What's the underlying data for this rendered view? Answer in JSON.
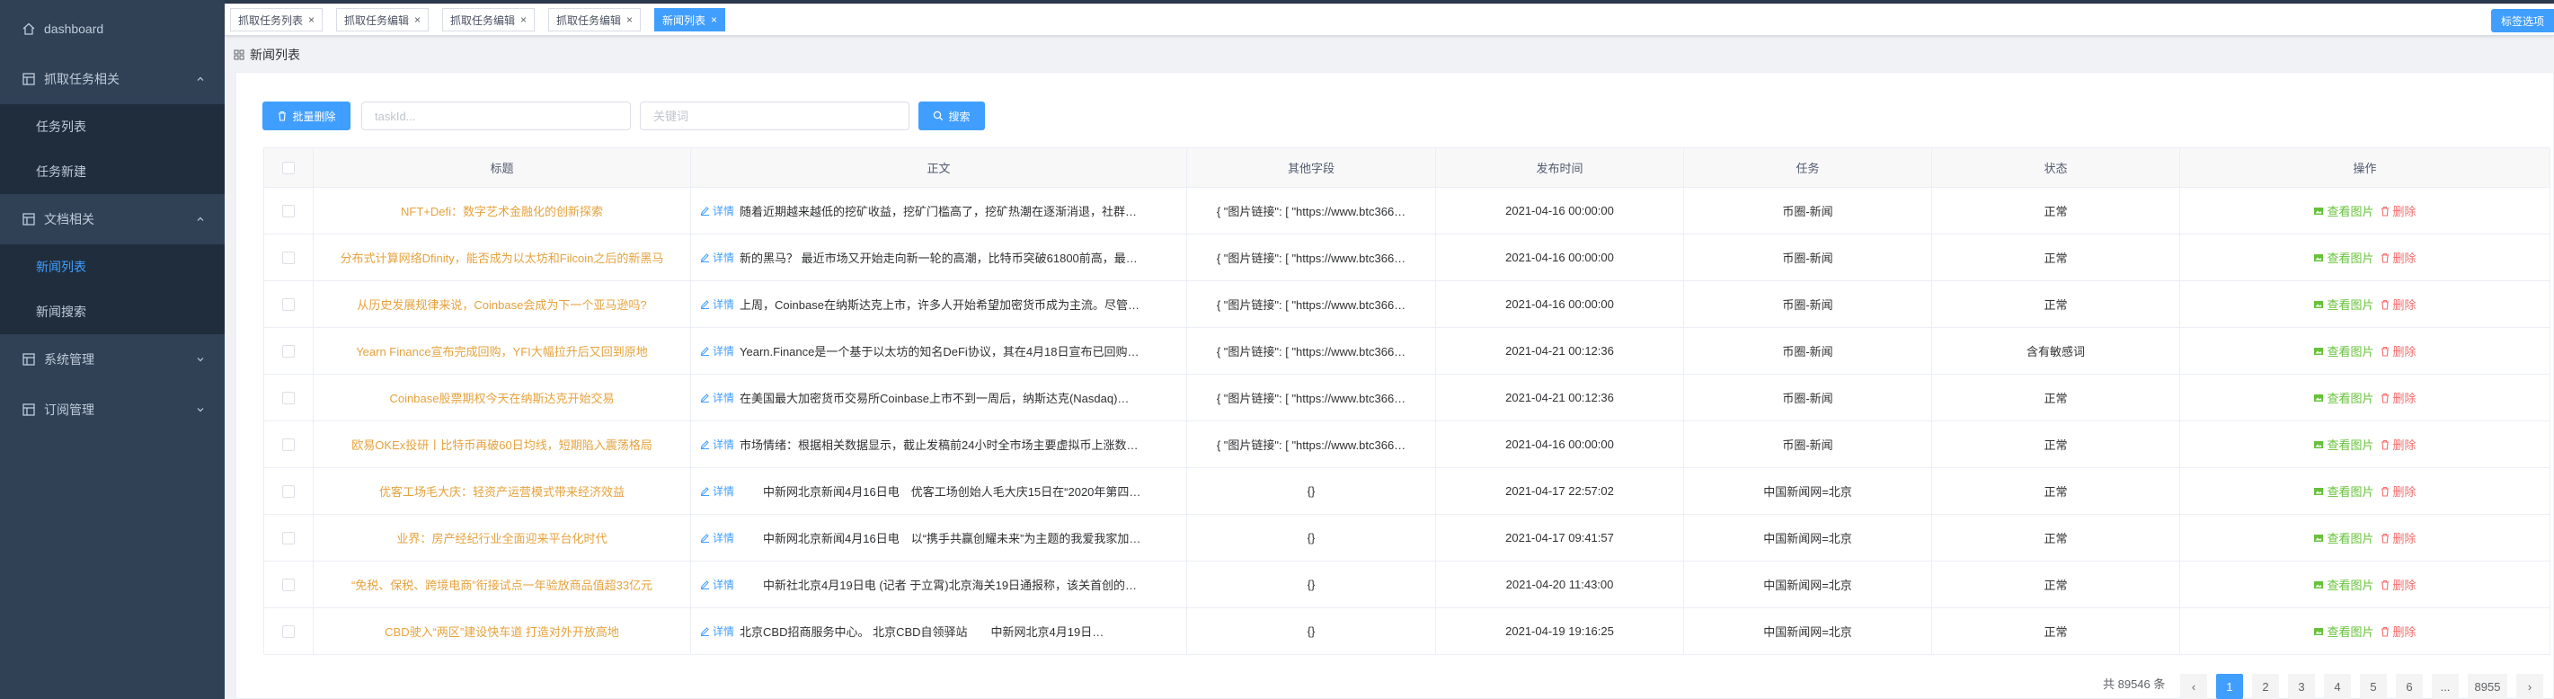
{
  "sidebar": {
    "items": [
      {
        "label": "dashboard",
        "icon": "home-icon"
      },
      {
        "label": "抓取任务相关",
        "icon": "grid-icon",
        "expanded": true,
        "children": [
          "任务列表",
          "任务新建"
        ]
      },
      {
        "label": "文档相关",
        "icon": "grid-icon",
        "expanded": true,
        "children": [
          "新闻列表",
          "新闻搜索"
        ]
      },
      {
        "label": "系统管理",
        "icon": "grid-icon",
        "expanded": false
      },
      {
        "label": "订阅管理",
        "icon": "grid-icon",
        "expanded": false
      }
    ],
    "sub": {
      "task_list": "任务列表",
      "task_new": "任务新建",
      "news_list": "新闻列表",
      "news_search": "新闻搜索"
    },
    "active_item": "新闻列表"
  },
  "tags": [
    {
      "label": "抓取任务列表"
    },
    {
      "label": "抓取任务编辑"
    },
    {
      "label": "抓取任务编辑"
    },
    {
      "label": "抓取任务编辑"
    },
    {
      "label": "新闻列表",
      "active": true
    }
  ],
  "tags_menu_label": "标签选项",
  "breadcrumb": "新闻列表",
  "toolbar": {
    "batch_delete_label": "批量删除",
    "taskid_placeholder": "taskId...",
    "keyword_placeholder": "关键词",
    "search_label": "搜索"
  },
  "table": {
    "headers": {
      "title": "标题",
      "body": "正文",
      "other": "其他字段",
      "time": "发布时间",
      "task": "任务",
      "status": "状态",
      "ops": "操作"
    },
    "detail_label": "详情",
    "view_image_label": "查看图片",
    "delete_label": "删除",
    "rows": [
      {
        "title": "NFT+Defi：数字艺术金融化的创新探索",
        "body": "随着近期越来越低的挖矿收益，挖矿门槛高了，挖矿热潮在逐渐消退，社群…",
        "other": "{ \"图片链接\": [ \"https://www.btc366…",
        "time": "2021-04-16 00:00:00",
        "task": "币圈-新闻",
        "status": "正常"
      },
      {
        "title": "分布式计算网络Dfinity，能否成为以太坊和Filcoin之后的新黑马",
        "body": "新的黑马？ 最近市场又开始走向新一轮的高潮，比特币突破61800前高，最…",
        "other": "{ \"图片链接\": [ \"https://www.btc366…",
        "time": "2021-04-16 00:00:00",
        "task": "币圈-新闻",
        "status": "正常"
      },
      {
        "title": "从历史发展规律来说，Coinbase会成为下一个亚马逊吗?",
        "body": "上周，Coinbase在纳斯达克上市，许多人开始希望加密货币成为主流。尽管…",
        "other": "{ \"图片链接\": [ \"https://www.btc366…",
        "time": "2021-04-16 00:00:00",
        "task": "币圈-新闻",
        "status": "正常"
      },
      {
        "title": "Yearn Finance宣布完成回购，YFI大幅拉升后又回到原地",
        "body": "Yearn.Finance是一个基于以太坊的知名DeFi协议，其在4月18日宣布已回购…",
        "other": "{ \"图片链接\": [ \"https://www.btc366…",
        "time": "2021-04-21 00:12:36",
        "task": "币圈-新闻",
        "status": "含有敏感词"
      },
      {
        "title": "Coinbase股票期权今天在纳斯达克开始交易",
        "body": "在美国最大加密货币交易所Coinbase上市不到一周后，纳斯达克(Nasdaq)…",
        "other": "{ \"图片链接\": [ \"https://www.btc366…",
        "time": "2021-04-21 00:12:36",
        "task": "币圈-新闻",
        "status": "正常"
      },
      {
        "title": "欧易OKEx投研丨比特币再破60日均线，短期陷入震荡格局",
        "body": "市场情绪：根据相关数据显示，截止发稿前24小时全市场主要虚拟币上涨数…",
        "other": "{ \"图片链接\": [ \"https://www.btc366…",
        "time": "2021-04-16 00:00:00",
        "task": "币圈-新闻",
        "status": "正常"
      },
      {
        "title": "优客工场毛大庆：轻资产运营模式带来经济效益",
        "body": "　　中新网北京新闻4月16日电　优客工场创始人毛大庆15日在“2020年第四…",
        "other": "{}",
        "time": "2021-04-17 22:57:02",
        "task": "中国新闻网=北京",
        "status": "正常"
      },
      {
        "title": "业界：房产经纪行业全面迎来平台化时代",
        "body": "　　中新网北京新闻4月16日电　以“携手共赢创耀未来”为主题的我爱我家加…",
        "other": "{}",
        "time": "2021-04-17 09:41:57",
        "task": "中国新闻网=北京",
        "status": "正常"
      },
      {
        "title": "“免税、保税、跨境电商”衔接试点一年验放商品值超33亿元",
        "body": "　　中新社北京4月19日电 (记者 于立霄)北京海关19日通报称，该关首创的…",
        "other": "{}",
        "time": "2021-04-20 11:43:00",
        "task": "中国新闻网=北京",
        "status": "正常"
      },
      {
        "title": "CBD驶入“两区”建设快车道 打造对外开放高地",
        "body": "北京CBD招商服务中心。 北京CBD自领驿站　　中新网北京4月19日…",
        "other": "{}",
        "time": "2021-04-19 19:16:25",
        "task": "中国新闻网=北京",
        "status": "正常"
      }
    ]
  },
  "pagination": {
    "total_label": "共 89546 条",
    "pages": [
      "1",
      "2",
      "3",
      "4",
      "5",
      "6",
      "...",
      "8955"
    ],
    "current": "1",
    "prev": "‹",
    "next": "›"
  },
  "colors": {
    "sidebar_bg": "#304156",
    "accent": "#409eff",
    "title_link": "#e6a23c",
    "view_image": "#67c23a",
    "delete": "#f56c6c"
  }
}
